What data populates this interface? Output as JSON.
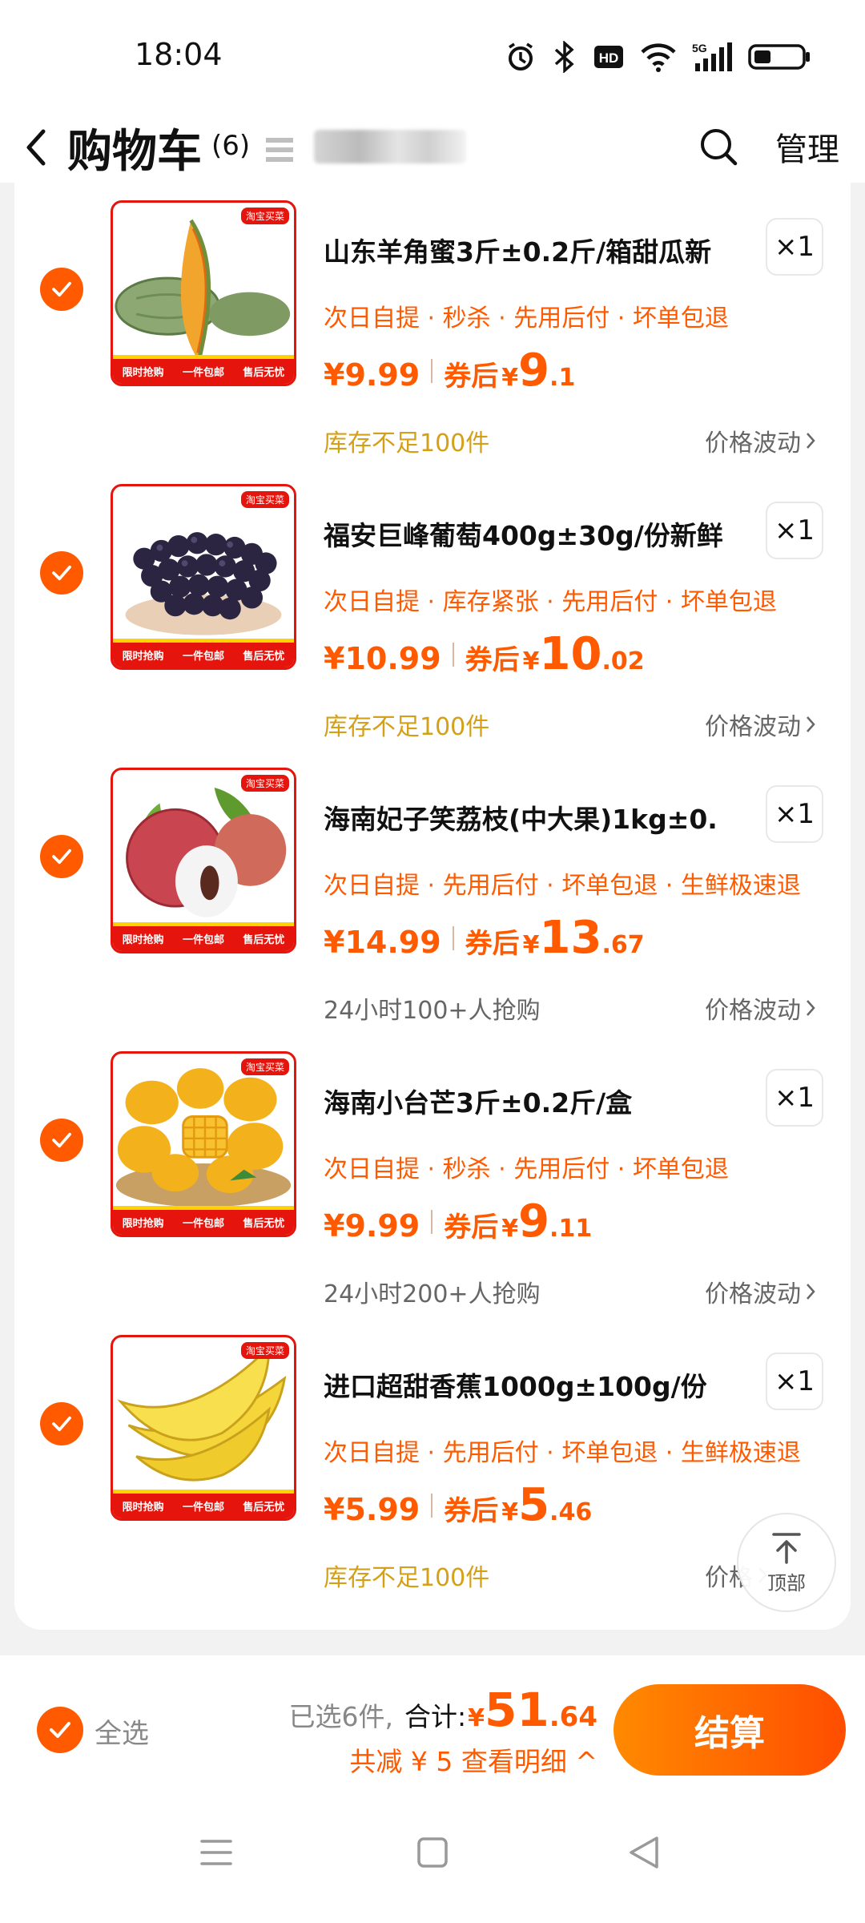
{
  "status_bar": {
    "time": "18:04",
    "icons": [
      "alarm-icon",
      "bluetooth-icon",
      "hd-icon",
      "wifi-icon",
      "5g-signal-icon",
      "battery-icon"
    ],
    "hd_text": "HD",
    "network_text": "5G"
  },
  "header": {
    "title": "购物车",
    "count": "(6)"
  },
  "colors": {
    "accent": "#ff5a00",
    "stock_note": "#d4a017",
    "thumb_red": "#e5140c"
  },
  "items": [
    {
      "title": "山东羊角蜜3斤±0.2斤/箱甜瓜新",
      "qty": "×1",
      "tags": "次日自提 · 秒杀 · 先用后付 · 坏单包退",
      "price_original": "¥9.99",
      "coupon_label": "券后",
      "coupon_yen": "¥",
      "coupon_int": "9",
      "coupon_dec": ".1",
      "note": "库存不足100件",
      "note_kind": "stock",
      "fluctuation": "价格波动",
      "image": "melon"
    },
    {
      "title": "福安巨峰葡萄400g±30g/份新鲜",
      "qty": "×1",
      "tags": "次日自提 · 库存紧张 · 先用后付 · 坏单包退",
      "price_original": "¥10.99",
      "coupon_label": "券后",
      "coupon_yen": "¥",
      "coupon_int": "10",
      "coupon_dec": ".02",
      "note": "库存不足100件",
      "note_kind": "stock",
      "fluctuation": "价格波动",
      "image": "grapes"
    },
    {
      "title": "海南妃子笑荔枝(中大果)1kg±0.",
      "qty": "×1",
      "tags": "次日自提 · 先用后付 · 坏单包退 · 生鲜极速退",
      "price_original": "¥14.99",
      "coupon_label": "券后",
      "coupon_yen": "¥",
      "coupon_int": "13",
      "coupon_dec": ".67",
      "note": "24小时100+人抢购",
      "note_kind": "grey",
      "fluctuation": "价格波动",
      "image": "lychee"
    },
    {
      "title": "海南小台芒3斤±0.2斤/盒",
      "qty": "×1",
      "tags": "次日自提 · 秒杀 · 先用后付 · 坏单包退",
      "price_original": "¥9.99",
      "coupon_label": "券后",
      "coupon_yen": "¥",
      "coupon_int": "9",
      "coupon_dec": ".11",
      "note": "24小时200+人抢购",
      "note_kind": "grey",
      "fluctuation": "价格波动",
      "image": "mango"
    },
    {
      "title": "进口超甜香蕉1000g±100g/份",
      "qty": "×1",
      "tags": "次日自提 · 先用后付 · 坏单包退 · 生鲜极速退",
      "price_original": "¥5.99",
      "coupon_label": "券后",
      "coupon_yen": "¥",
      "coupon_int": "5",
      "coupon_dec": ".46",
      "note": "库存不足100件",
      "note_kind": "stock",
      "fluctuation": "价格",
      "image": "banana"
    }
  ],
  "thumb_badge": "淘宝买菜",
  "thumb_strip": [
    "限时抢购",
    "一件包邮",
    "售后无忧"
  ],
  "back_to_top": {
    "label": "顶部"
  },
  "footer": {
    "select_all_label": "全选",
    "selected_count": "已选6件,",
    "total_label": "合计:",
    "total_yen": "¥",
    "total_int": "51",
    "total_dec": ".64",
    "discount_text": "共减 ¥ 5  查看明细 ^",
    "checkout_label": "结算"
  },
  "nav_bar": {
    "icons": [
      "menu-icon",
      "home-square-icon",
      "back-triangle-icon"
    ]
  }
}
